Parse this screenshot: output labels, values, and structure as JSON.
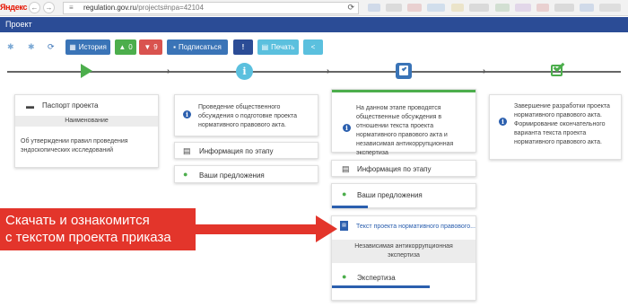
{
  "browser": {
    "brand": "Яндекс",
    "url_host": "regulation.gov.ru",
    "url_path": "/projects#npa=42104",
    "back_label": "←",
    "forward_label": "→",
    "reload_label": "⟳"
  },
  "header": {
    "title": "Проект"
  },
  "toolbar": {
    "history_label": "История",
    "likes_label": "0",
    "dislikes_label": "9",
    "subscribe_label": "Подписаться",
    "info_label": "!",
    "print_label": "Печать",
    "share_label": "<",
    "colors": {
      "history": "#3a74b7",
      "likes": "#4cae4c",
      "dislikes": "#d9534f",
      "subscribe": "#3a74b7",
      "info": "#2b4c96",
      "print": "#5bc0de",
      "share": "#5bc0de"
    }
  },
  "stages": [
    {
      "passport_label": "Паспорт проекта",
      "name_header": "Наименование",
      "name_value": "Об утверждении правил проведения эндоскопических исследований"
    },
    {
      "description": "Проведение общественного обсуждения о подготовке проекта нормативного правового акта.",
      "info_label": "Информация по этапу",
      "proposals_label": "Ваши предложения"
    },
    {
      "description": "На данном этапе проводятся общественные обсуждения в отношении текста проекта нормативного правового акта и независимая антикоррупционная экспертиза",
      "info_label": "Информация по этапу",
      "proposals_label": "Ваши предложения",
      "document_link": "Текст проекта нормативного правового...",
      "anticorruption_header": "Независимая антикоррупционная экспертиза",
      "expertise_label": "Экспертиза"
    },
    {
      "description": "Завершение разработки проекта нормативного правового акта. Формирование окончательного варианта текста проекта нормативного правового акта."
    }
  ],
  "annotation": {
    "line1": "Скачать и ознакомится",
    "line2": "с текстом проекта приказа"
  }
}
